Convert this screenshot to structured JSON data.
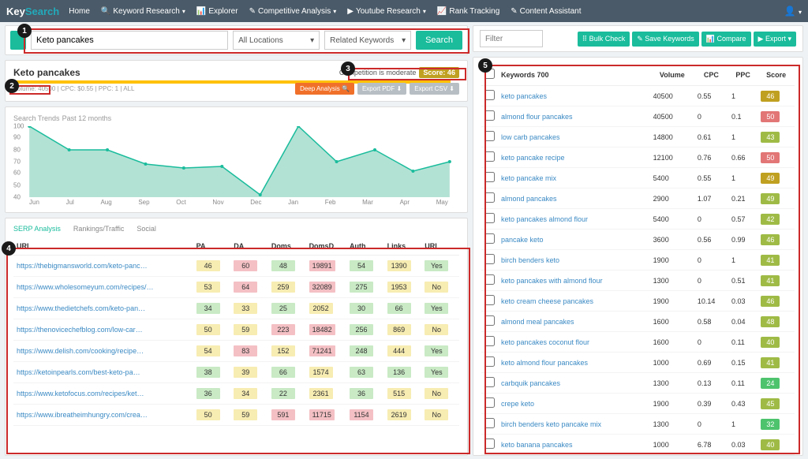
{
  "nav": {
    "logo_a": "Key",
    "logo_b": "Search",
    "items": [
      "Home",
      "Keyword Research",
      "Explorer",
      "Competitive Analysis",
      "Youtube Research",
      "Rank Tracking",
      "Content Assistant"
    ]
  },
  "search": {
    "query": "Keto pancakes",
    "loc": "All Locations",
    "type": "Related Keywords",
    "btn": "Search"
  },
  "meta": {
    "title": "Keto pancakes",
    "info": "Volume: 40500 | CPC: $0.55 | PPC: 1 | ALL",
    "comp_text": "Competition is moderate",
    "comp_score": "Score: 46",
    "deep": "Deep Analysis ",
    "pdf": "Export PDF ",
    "csv": "Export CSV "
  },
  "chart": {
    "title": "Search Trends",
    "sub": "Past 12 months",
    "ylabels": [
      "100",
      "90",
      "80",
      "70",
      "60",
      "50",
      "40"
    ],
    "xlabels": [
      "Jun",
      "Jul",
      "Aug",
      "Sep",
      "Oct",
      "Nov",
      "Dec",
      "Jan",
      "Feb",
      "Mar",
      "Apr",
      "May"
    ]
  },
  "chart_data": {
    "type": "area",
    "title": "Search Trends — Past 12 months",
    "x": [
      "Jun",
      "Jul",
      "Aug",
      "Sep",
      "Oct",
      "Nov",
      "Dec",
      "Jan",
      "Feb",
      "Mar",
      "Apr",
      "May"
    ],
    "values": [
      100,
      80,
      80,
      68,
      65,
      66,
      42,
      100,
      70,
      80,
      62,
      70
    ],
    "ylim": [
      40,
      100
    ]
  },
  "tabs": {
    "a": "SERP Analysis",
    "b": "Rankings/Traffic",
    "c": "Social"
  },
  "serp": {
    "cols": [
      "URL",
      "PA",
      "DA",
      "Doms",
      "DomsD",
      "Auth",
      "Links",
      "URL"
    ],
    "rows": [
      {
        "u": "https://thebigmansworld.com/keto-panc…",
        "pa": "46",
        "pac": "y",
        "da": "60",
        "dac": "r",
        "doms": "48",
        "domsc": "g",
        "domsd": "19891",
        "domsdc": "r",
        "auth": "54",
        "authc": "g",
        "links": "1390",
        "linksc": "y",
        "url": "Yes",
        "urlc": "g"
      },
      {
        "u": "https://www.wholesomeyum.com/recipes/…",
        "pa": "53",
        "pac": "y",
        "da": "64",
        "dac": "r",
        "doms": "259",
        "domsc": "y",
        "domsd": "32089",
        "domsdc": "r",
        "auth": "275",
        "authc": "g",
        "links": "1953",
        "linksc": "y",
        "url": "No",
        "urlc": "y"
      },
      {
        "u": "https://www.thedietchefs.com/keto-pan…",
        "pa": "34",
        "pac": "g",
        "da": "33",
        "dac": "y",
        "doms": "25",
        "domsc": "g",
        "domsd": "2052",
        "domsdc": "y",
        "auth": "30",
        "authc": "g",
        "links": "66",
        "linksc": "g",
        "url": "Yes",
        "urlc": "g"
      },
      {
        "u": "https://thenovicechefblog.com/low-car…",
        "pa": "50",
        "pac": "y",
        "da": "59",
        "dac": "y",
        "doms": "223",
        "domsc": "r",
        "domsd": "18482",
        "domsdc": "r",
        "auth": "256",
        "authc": "g",
        "links": "869",
        "linksc": "y",
        "url": "No",
        "urlc": "y"
      },
      {
        "u": "https://www.delish.com/cooking/recipe…",
        "pa": "54",
        "pac": "y",
        "da": "83",
        "dac": "r",
        "doms": "152",
        "domsc": "y",
        "domsd": "71241",
        "domsdc": "r",
        "auth": "248",
        "authc": "g",
        "links": "444",
        "linksc": "y",
        "url": "Yes",
        "urlc": "g"
      },
      {
        "u": "https://ketoinpearls.com/best-keto-pa…",
        "pa": "38",
        "pac": "g",
        "da": "39",
        "dac": "y",
        "doms": "66",
        "domsc": "g",
        "domsd": "1574",
        "domsdc": "y",
        "auth": "63",
        "authc": "g",
        "links": "136",
        "linksc": "g",
        "url": "Yes",
        "urlc": "g"
      },
      {
        "u": "https://www.ketofocus.com/recipes/ket…",
        "pa": "36",
        "pac": "g",
        "da": "34",
        "dac": "y",
        "doms": "22",
        "domsc": "g",
        "domsd": "2361",
        "domsdc": "y",
        "auth": "36",
        "authc": "g",
        "links": "515",
        "linksc": "y",
        "url": "No",
        "urlc": "y"
      },
      {
        "u": "https://www.ibreatheimhungry.com/crea…",
        "pa": "50",
        "pac": "y",
        "da": "59",
        "dac": "y",
        "doms": "591",
        "domsc": "r",
        "domsd": "11715",
        "domsdc": "r",
        "auth": "1154",
        "authc": "r",
        "links": "2619",
        "linksc": "y",
        "url": "No",
        "urlc": "y"
      }
    ]
  },
  "right": {
    "filter_ph": "Filter",
    "btns": [
      "⠿ Bulk Check",
      "✎ Save Keywords",
      "📊 Compare",
      "▶ Export"
    ],
    "head": {
      "kw": "Keywords 700",
      "vol": "Volume",
      "cpc": "CPC",
      "ppc": "PPC",
      "score": "Score"
    },
    "rows": [
      {
        "k": "keto pancakes",
        "v": "40500",
        "c": "0.55",
        "p": "1",
        "s": "46",
        "sc": "so"
      },
      {
        "k": "almond flour pancakes",
        "v": "40500",
        "c": "0",
        "p": "0.1",
        "s": "50",
        "sc": "sr"
      },
      {
        "k": "low carb pancakes",
        "v": "14800",
        "c": "0.61",
        "p": "1",
        "s": "43",
        "sc": "syg"
      },
      {
        "k": "keto pancake recipe",
        "v": "12100",
        "c": "0.76",
        "p": "0.66",
        "s": "50",
        "sc": "sr"
      },
      {
        "k": "keto pancake mix",
        "v": "5400",
        "c": "0.55",
        "p": "1",
        "s": "49",
        "sc": "so"
      },
      {
        "k": "almond pancakes",
        "v": "2900",
        "c": "1.07",
        "p": "0.21",
        "s": "49",
        "sc": "syg"
      },
      {
        "k": "keto pancakes almond flour",
        "v": "5400",
        "c": "0",
        "p": "0.57",
        "s": "42",
        "sc": "syg"
      },
      {
        "k": "pancake keto",
        "v": "3600",
        "c": "0.56",
        "p": "0.99",
        "s": "46",
        "sc": "syg"
      },
      {
        "k": "birch benders keto",
        "v": "1900",
        "c": "0",
        "p": "1",
        "s": "41",
        "sc": "syg"
      },
      {
        "k": "keto pancakes with almond flour",
        "v": "1300",
        "c": "0",
        "p": "0.51",
        "s": "41",
        "sc": "syg"
      },
      {
        "k": "keto cream cheese pancakes",
        "v": "1900",
        "c": "10.14",
        "p": "0.03",
        "s": "46",
        "sc": "syg"
      },
      {
        "k": "almond meal pancakes",
        "v": "1600",
        "c": "0.58",
        "p": "0.04",
        "s": "48",
        "sc": "syg"
      },
      {
        "k": "keto pancakes coconut flour",
        "v": "1600",
        "c": "0",
        "p": "0.11",
        "s": "40",
        "sc": "syg"
      },
      {
        "k": "keto almond flour pancakes",
        "v": "1000",
        "c": "0.69",
        "p": "0.15",
        "s": "41",
        "sc": "syg"
      },
      {
        "k": "carbquik pancakes",
        "v": "1300",
        "c": "0.13",
        "p": "0.11",
        "s": "24",
        "sc": "sg"
      },
      {
        "k": "crepe keto",
        "v": "1900",
        "c": "0.39",
        "p": "0.43",
        "s": "45",
        "sc": "syg"
      },
      {
        "k": "birch benders keto pancake mix",
        "v": "1300",
        "c": "0",
        "p": "1",
        "s": "32",
        "sc": "sg"
      },
      {
        "k": "keto banana pancakes",
        "v": "1000",
        "c": "6.78",
        "p": "0.03",
        "s": "40",
        "sc": "syg"
      }
    ]
  }
}
